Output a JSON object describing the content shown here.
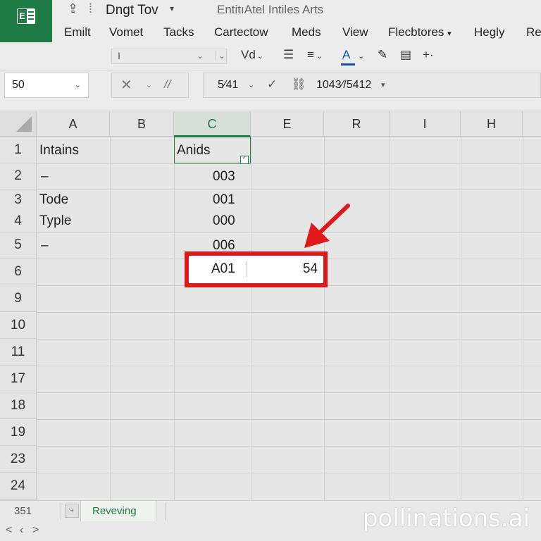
{
  "titlebar": {
    "doc_title": "Dngt Tov",
    "app_subtitle": "EntitıAtel Intiles Arts",
    "title_dropdown": "▾",
    "upload_icon": "upload-icon",
    "separator": "⁞"
  },
  "menu": {
    "items": [
      "Emilt",
      "Vomet",
      "Tacks",
      "Cartectow",
      "Meds",
      "View",
      "Flecbtores",
      "Hegly",
      "Re"
    ],
    "dropdown_marker": "▾"
  },
  "toolbar": {
    "font_value": "I",
    "chev": "⌄",
    "vd_label": "Vd",
    "vd_chev": "⌄",
    "list_icon": "☰",
    "align_icon": "≡",
    "align_chev": "⌄",
    "font_color_label": "A",
    "font_color_chev": "⌄",
    "pen_icon": "✎",
    "table_icon": "▤",
    "move_icon": "+·",
    "accent_color": "#1a4fa8"
  },
  "formula_bar": {
    "name_box": "50",
    "name_chev": "⌄",
    "cancel": "✕",
    "cancel_chev": "⌄",
    "slash": "//",
    "formula_value": "5⁄41",
    "formula_chev": "⌄",
    "confirm": "✓",
    "link": "🔗",
    "reference": "1043⁄/5412",
    "reference_chev": "▾"
  },
  "grid": {
    "columns": [
      "A",
      "B",
      "C",
      "E",
      "R",
      "I",
      "H"
    ],
    "active_column": "C",
    "rows": [
      "1",
      "2",
      "3",
      "4",
      "5",
      "6",
      "9",
      "10",
      "11",
      "17",
      "18",
      "19",
      "23",
      "24"
    ],
    "cells": {
      "a1": "Intains",
      "c1": "Anids",
      "a2": "–",
      "c2": "003",
      "a3": "Tode",
      "c3": "001",
      "a4": "Typle",
      "c4": "000",
      "a5": "–",
      "c5": "006",
      "c6": "A01",
      "e6": "54"
    },
    "highlight_color": "#e01818",
    "active_color": "#1e7b44",
    "fill_handle_mark": "✓"
  },
  "statusbar": {
    "sheet_count": "351",
    "add_icon": "⤷",
    "sheet_tab": "Reveving",
    "nav_prev": "<",
    "nav_mid": "‹",
    "nav_next": ">"
  },
  "watermark": "pollinations.ai"
}
